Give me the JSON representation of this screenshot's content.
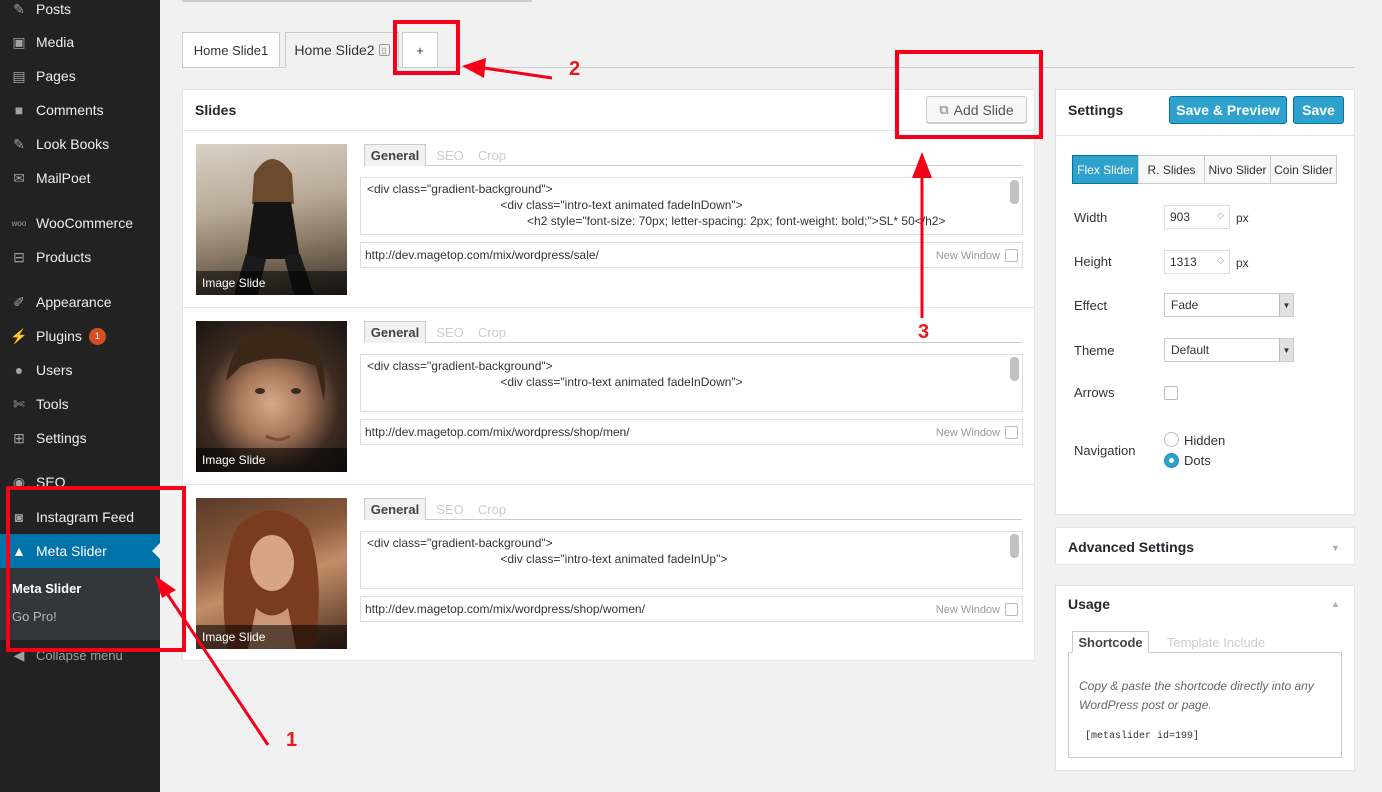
{
  "sidebar": {
    "items": [
      {
        "label": "Posts",
        "icon": "pushpin-icon"
      },
      {
        "label": "Media",
        "icon": "media-icon"
      },
      {
        "label": "Pages",
        "icon": "pages-icon"
      },
      {
        "label": "Comments",
        "icon": "comment-icon"
      },
      {
        "label": "Look Books",
        "icon": "pushpin-icon"
      },
      {
        "label": "MailPoet",
        "icon": "mail-icon"
      },
      {
        "label": "WooCommerce",
        "icon": "woo-icon"
      },
      {
        "label": "Products",
        "icon": "cart-icon"
      },
      {
        "label": "Appearance",
        "icon": "brush-icon"
      },
      {
        "label": "Plugins",
        "icon": "plugin-icon",
        "badge": "1"
      },
      {
        "label": "Users",
        "icon": "user-icon"
      },
      {
        "label": "Tools",
        "icon": "wrench-icon"
      },
      {
        "label": "Settings",
        "icon": "settings-icon"
      },
      {
        "label": "SEO",
        "icon": "seo-icon"
      },
      {
        "label": "Instagram Feed",
        "icon": "camera-icon"
      },
      {
        "label": "Meta Slider",
        "icon": "slider-icon"
      }
    ],
    "submenu": [
      "Meta Slider",
      "Go Pro!"
    ],
    "collapse": "Collapse menu"
  },
  "tabs": {
    "tab1": "Home Slide1",
    "tab2": "Home Slide2",
    "add": "+"
  },
  "slides_panel": {
    "title": "Slides",
    "add_button": "Add Slide",
    "slide_tabs": [
      "General",
      "SEO",
      "Crop"
    ],
    "new_window_label": "New Window",
    "slides": [
      {
        "thumb_label": "Image Slide",
        "code": "<div class=\"gradient-background\">\n                                        <div class=\"intro-text animated fadeInDown\">\n                                                <h2 style=\"font-size: 70px; letter-spacing: 2px; font-weight: bold;\">SL* 50</h2>",
        "url": "http://dev.magetop.com/mix/wordpress/sale/"
      },
      {
        "thumb_label": "Image Slide",
        "code": "<div class=\"gradient-background\">\n                                        <div class=\"intro-text animated fadeInDown\">",
        "url": "http://dev.magetop.com/mix/wordpress/shop/men/"
      },
      {
        "thumb_label": "Image Slide",
        "code": "<div class=\"gradient-background\">\n                                        <div class=\"intro-text animated fadeInUp\">",
        "url": "http://dev.magetop.com/mix/wordpress/shop/women/"
      }
    ]
  },
  "settings": {
    "title": "Settings",
    "save_preview": "Save & Preview",
    "save": "Save",
    "slider_types": [
      "Flex Slider",
      "R. Slides",
      "Nivo Slider",
      "Coin Slider"
    ],
    "width_label": "Width",
    "width_value": "903",
    "height_label": "Height",
    "height_value": "1313",
    "unit": "px",
    "effect_label": "Effect",
    "effect_value": "Fade",
    "theme_label": "Theme",
    "theme_value": "Default",
    "arrows_label": "Arrows",
    "navigation_label": "Navigation",
    "nav_options": [
      "Hidden",
      "Dots"
    ]
  },
  "advanced": {
    "title": "Advanced Settings"
  },
  "usage": {
    "title": "Usage",
    "tabs": [
      "Shortcode",
      "Template Include"
    ],
    "description": "Copy & paste the shortcode directly into any WordPress post or page.",
    "shortcode": "[metaslider id=199]"
  },
  "annotations": {
    "one": "1",
    "two": "2",
    "three": "3"
  },
  "colors": {
    "accent": "#2ea2cc",
    "sidebar": "#222222",
    "active_menu": "#0073aa",
    "annotation": "#f40018"
  }
}
